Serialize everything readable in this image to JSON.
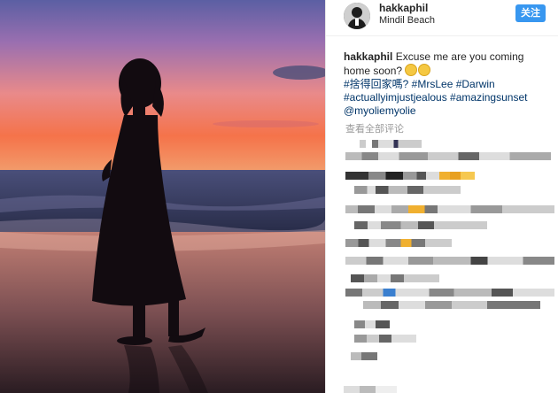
{
  "post": {
    "username": "hakkaphil",
    "location": "Mindil Beach",
    "follow_label": "关注"
  },
  "caption": {
    "username": "hakkaphil",
    "text": "Excuse me are you coming home soon?",
    "hashtags_line1": "#捨得回家嗎? #MrsLee #Darwin",
    "hashtags_line2": "#actuallyimjustjealous #amazingsunset",
    "mention": "@myoliemyolie"
  },
  "comments": {
    "view_all_label": "查看全部评论"
  },
  "colors": {
    "accent": "#3897f0",
    "link": "#003569",
    "text": "#262626"
  }
}
